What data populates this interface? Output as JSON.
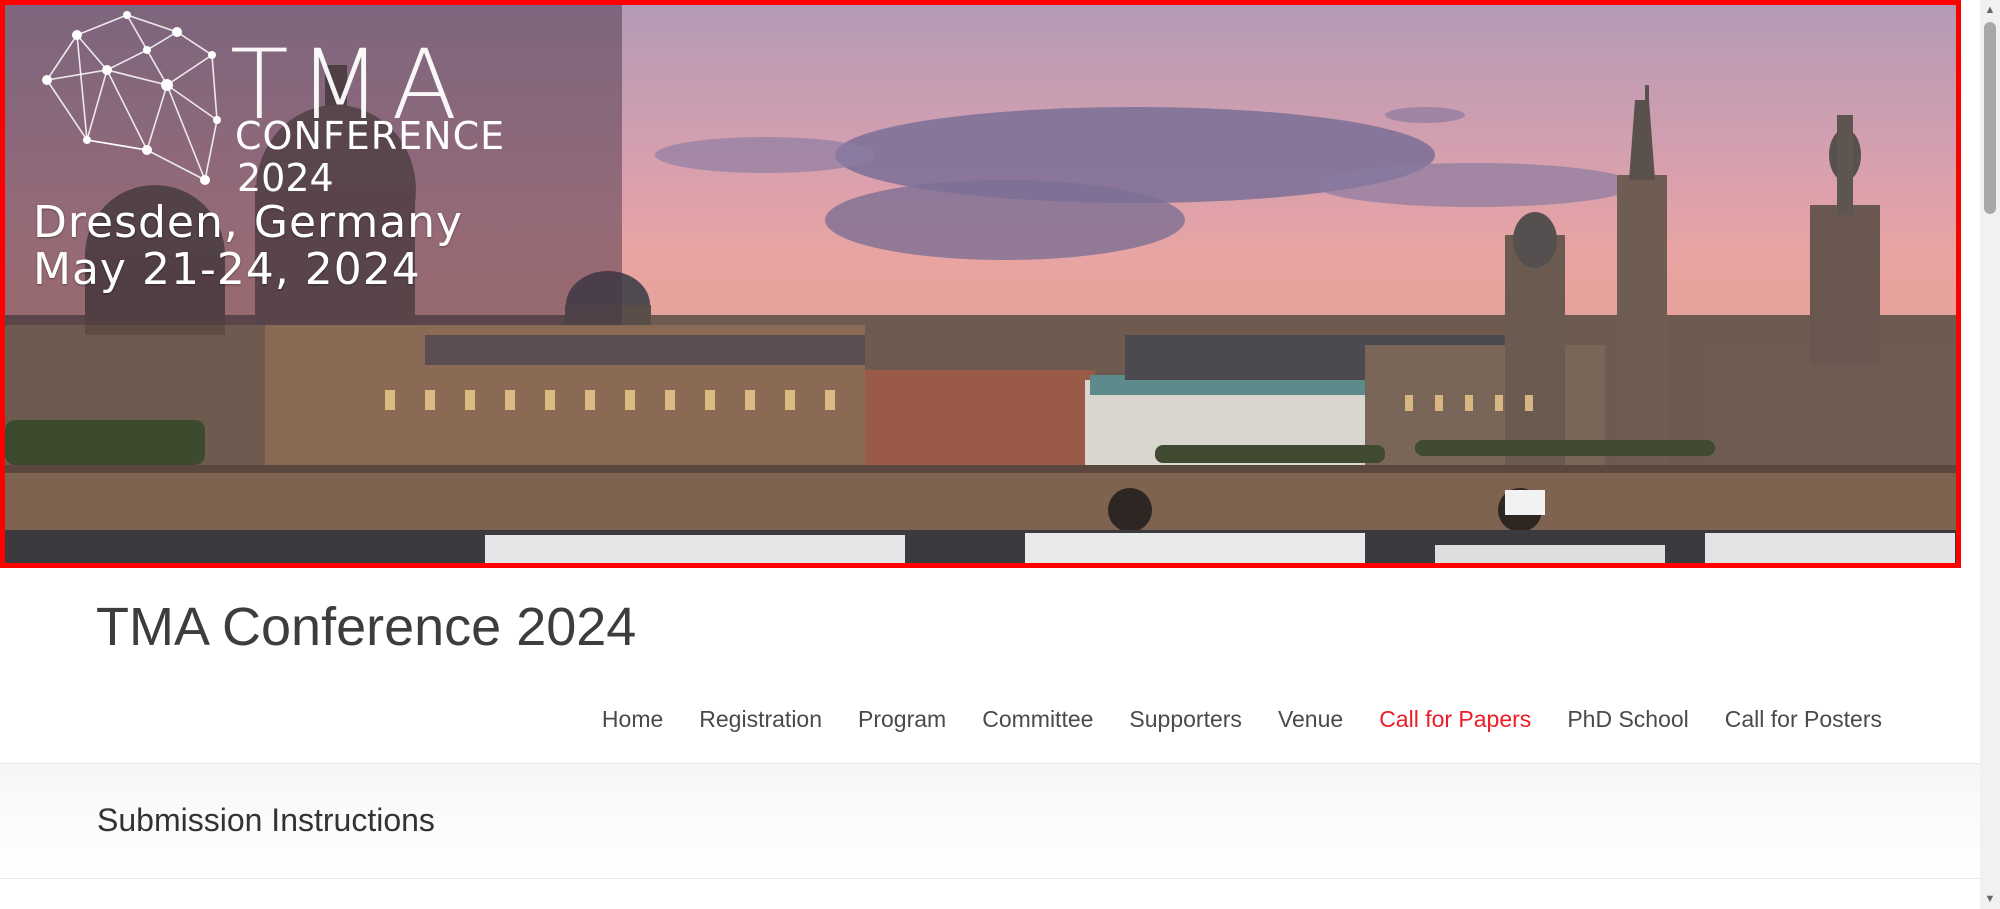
{
  "banner": {
    "logo_tma": "TMA",
    "logo_conference": "CONFERENCE",
    "logo_year": "2024",
    "city": "Dresden, Germany",
    "dates": "May 21-24, 2024",
    "logo_icon": "network-graph-icon",
    "border_color": "#ff0000"
  },
  "site": {
    "title": "TMA Conference 2024"
  },
  "nav": {
    "items": [
      {
        "label": "Home"
      },
      {
        "label": "Registration"
      },
      {
        "label": "Program"
      },
      {
        "label": "Committee"
      },
      {
        "label": "Supporters"
      },
      {
        "label": "Venue"
      },
      {
        "label": "Call for Papers",
        "active": true
      },
      {
        "label": "PhD School"
      },
      {
        "label": "Call for Posters"
      }
    ],
    "active_color": "#ee1c25"
  },
  "page": {
    "heading": "Submission Instructions"
  },
  "scrollbar": {
    "up_icon": "chevron-up-icon",
    "down_icon": "chevron-down-icon"
  }
}
